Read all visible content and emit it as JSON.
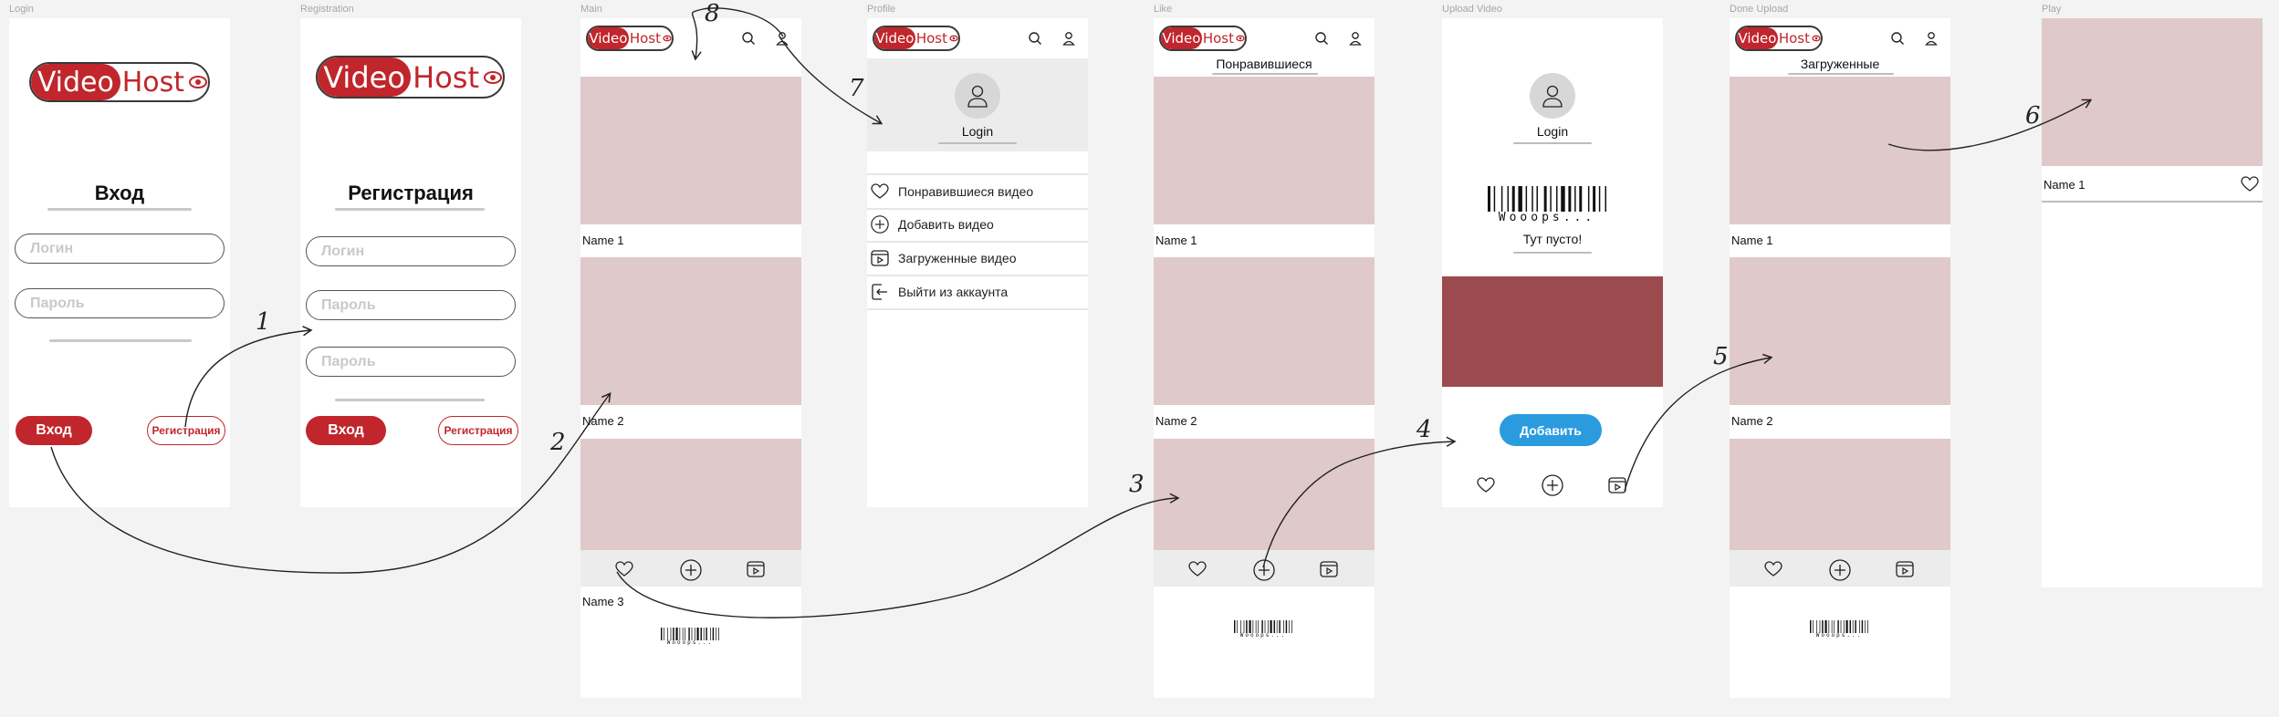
{
  "frames": {
    "login": "Login",
    "registration": "Registration",
    "main": "Main",
    "profile": "Profile",
    "like": "Like",
    "upload": "Upload Video",
    "done": "Done Upload",
    "play": "Play"
  },
  "logo": {
    "video": "Video",
    "host": "Host"
  },
  "login": {
    "title": "Вход",
    "login_placeholder": "Логин",
    "password_placeholder": "Пароль",
    "submit": "Вход",
    "register": "Регистрация"
  },
  "registration": {
    "title": "Регистрация",
    "login_placeholder": "Логин",
    "password_placeholder": "Пароль",
    "password2_placeholder": "Пароль",
    "submit": "Вход",
    "register": "Регистрация"
  },
  "main": {
    "items": [
      "Name 1",
      "Name 2",
      "Name 3"
    ],
    "barcode_text": "Wooops..."
  },
  "profile": {
    "username": "Login",
    "menu": [
      "Понравившиеся видео",
      "Добавить видео",
      "Загруженные видео",
      "Выйти из аккаунта"
    ]
  },
  "like": {
    "tab": "Понравившиеся",
    "items": [
      "Name 1",
      "Name 2"
    ],
    "barcode_text": "Wooops..."
  },
  "upload": {
    "username": "Login",
    "barcode_text": "Wooops...",
    "empty": "Тут пусто!",
    "add_button": "Добавить",
    "accent": "#9b4a4d",
    "button_color": "#2b9be0"
  },
  "done": {
    "tab": "Загруженные",
    "items": [
      "Name 1",
      "Name 2"
    ],
    "barcode_text": "Wooops..."
  },
  "play": {
    "name": "Name 1"
  },
  "annotations": [
    "1",
    "2",
    "3",
    "4",
    "5",
    "6",
    "7",
    "8"
  ],
  "colors": {
    "brand_red": "#c0262b",
    "thumb": "#e0c9cb",
    "background": "#f3f3f3"
  }
}
